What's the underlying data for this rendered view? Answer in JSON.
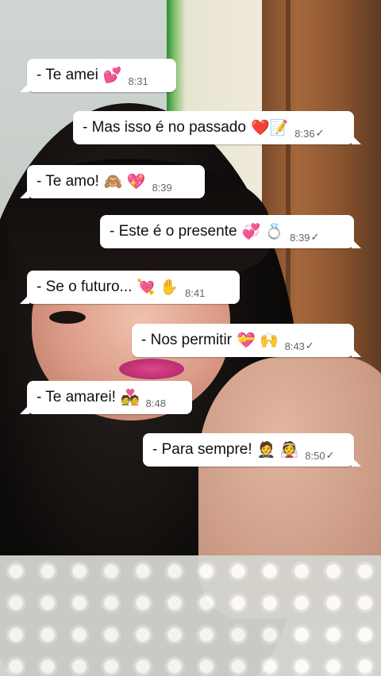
{
  "messages": [
    {
      "text": "- Te amei",
      "emoji": "💕",
      "time": "8:31",
      "direction": "in"
    },
    {
      "text": "- Mas isso é no passado",
      "emoji": "❤️📝",
      "time": "8:36",
      "direction": "out",
      "status": "✓"
    },
    {
      "text": "-  Te amo!",
      "emoji": "🙈 💖",
      "time": "8:39",
      "direction": "in"
    },
    {
      "text": "- Este é o presente",
      "emoji": "💞 💍",
      "time": "8:39",
      "direction": "out",
      "status": "✓"
    },
    {
      "text": "-  Se o futuro...",
      "emoji": "💘 ✋",
      "time": "8:41",
      "direction": "in"
    },
    {
      "text": "- Nos permitir",
      "emoji": "💝 🙌",
      "time": "8:43",
      "direction": "out",
      "status": "✓"
    },
    {
      "text": "- Te amarei!",
      "emoji": "💑",
      "time": "8:48",
      "direction": "in"
    },
    {
      "text": "- Para sempre!",
      "emoji": "🤵 👰",
      "time": "8:50",
      "direction": "out",
      "status": "✓"
    }
  ]
}
